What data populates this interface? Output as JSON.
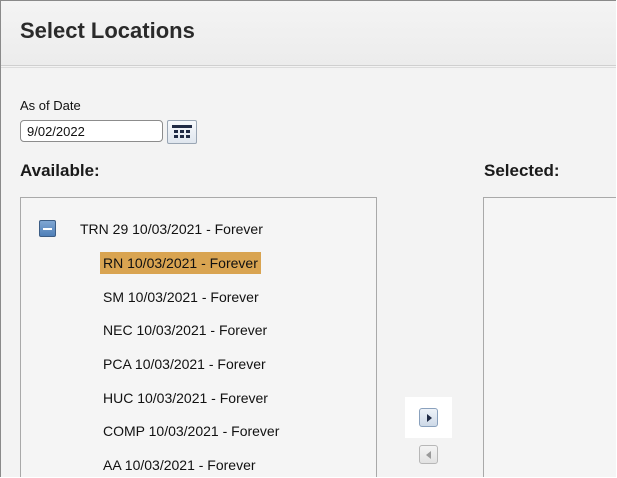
{
  "header": {
    "title": "Select Locations"
  },
  "as_of_date": {
    "label": "As of Date",
    "value": "9/02/2022"
  },
  "available": {
    "label": "Available:",
    "root": {
      "label": "TRN 29 10/03/2021 - Forever",
      "expanded": true
    },
    "children": [
      {
        "label": "RN 10/03/2021 - Forever",
        "selected": true
      },
      {
        "label": "SM 10/03/2021 - Forever",
        "selected": false
      },
      {
        "label": "NEC 10/03/2021 - Forever",
        "selected": false
      },
      {
        "label": "PCA 10/03/2021 - Forever",
        "selected": false
      },
      {
        "label": "HUC 10/03/2021 - Forever",
        "selected": false
      },
      {
        "label": "COMP 10/03/2021 - Forever",
        "selected": false
      },
      {
        "label": "AA 10/03/2021 - Forever",
        "selected": false
      }
    ]
  },
  "selected": {
    "label": "Selected:"
  },
  "icons": {
    "calendar": "calendar-icon",
    "collapse": "minus-icon",
    "move_right": "arrow-right-icon",
    "move_left": "arrow-left-icon"
  },
  "colors": {
    "selection": "#d9a451",
    "collapse_button": "#4f7fb7"
  }
}
